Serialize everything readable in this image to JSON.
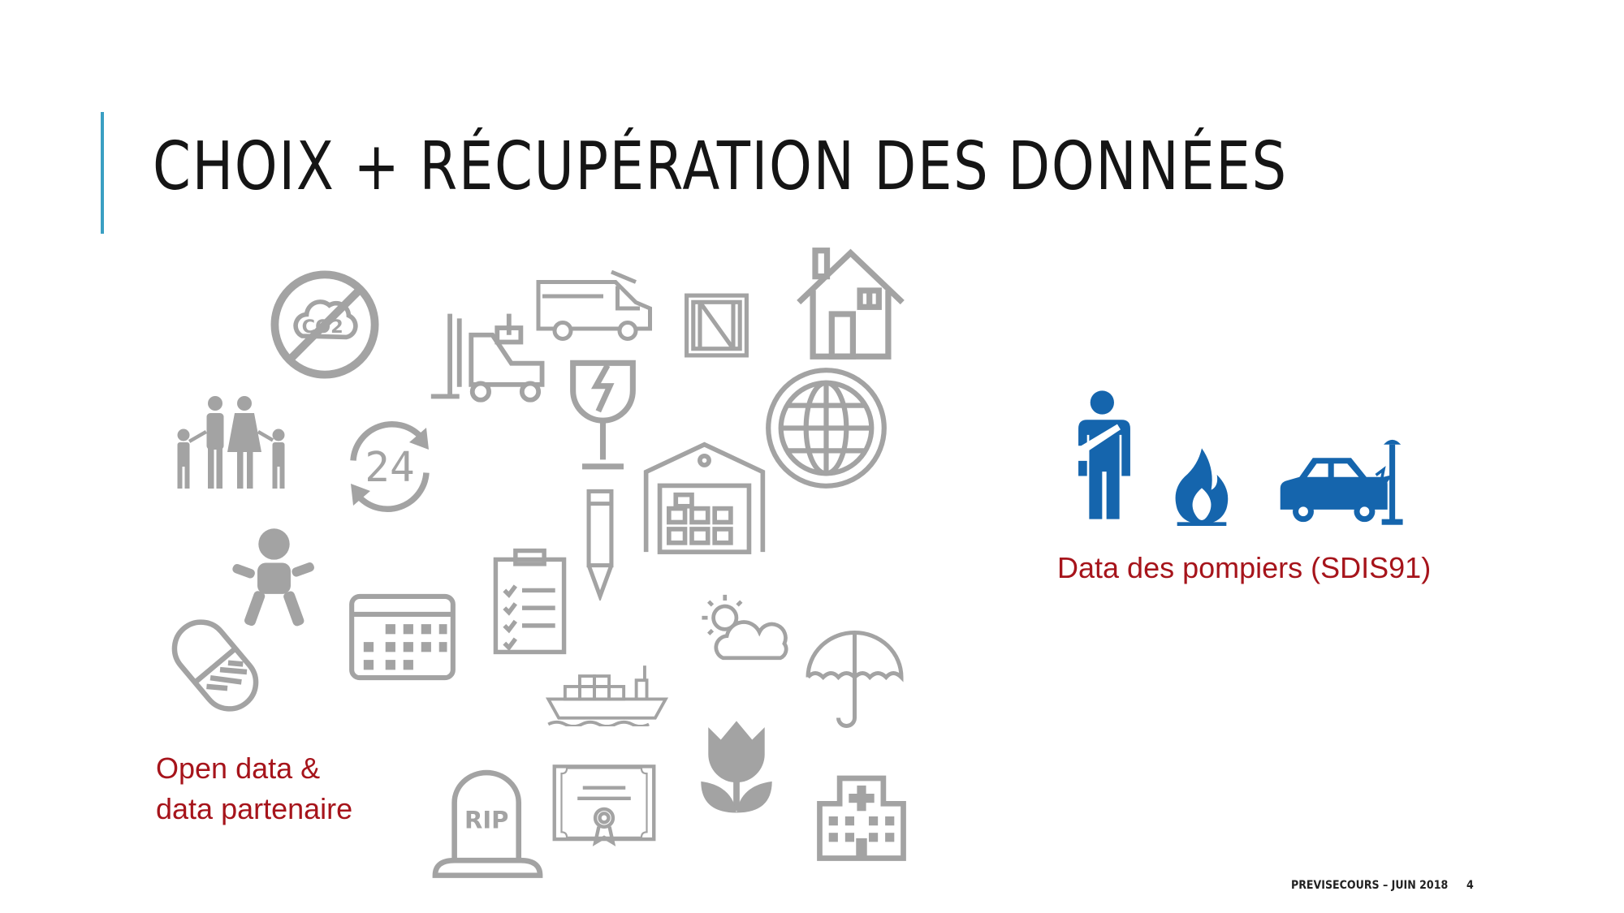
{
  "slide": {
    "title": "CHOIX + RÉCUPÉRATION DES DONNÉES",
    "page_number": "4",
    "footer": "PREVISECOURS – JUIN 2018"
  },
  "open_data": {
    "caption_line1": "Open data &",
    "caption_line2": "data partenaire",
    "icon_color": "#a3a3a3"
  },
  "sdis": {
    "caption": "Data des pompiers (SDIS91)",
    "icon_color": "#1565ad"
  },
  "icons": {
    "co2_text": "CO2",
    "clock_text": "24",
    "rip_text": "RIP"
  }
}
